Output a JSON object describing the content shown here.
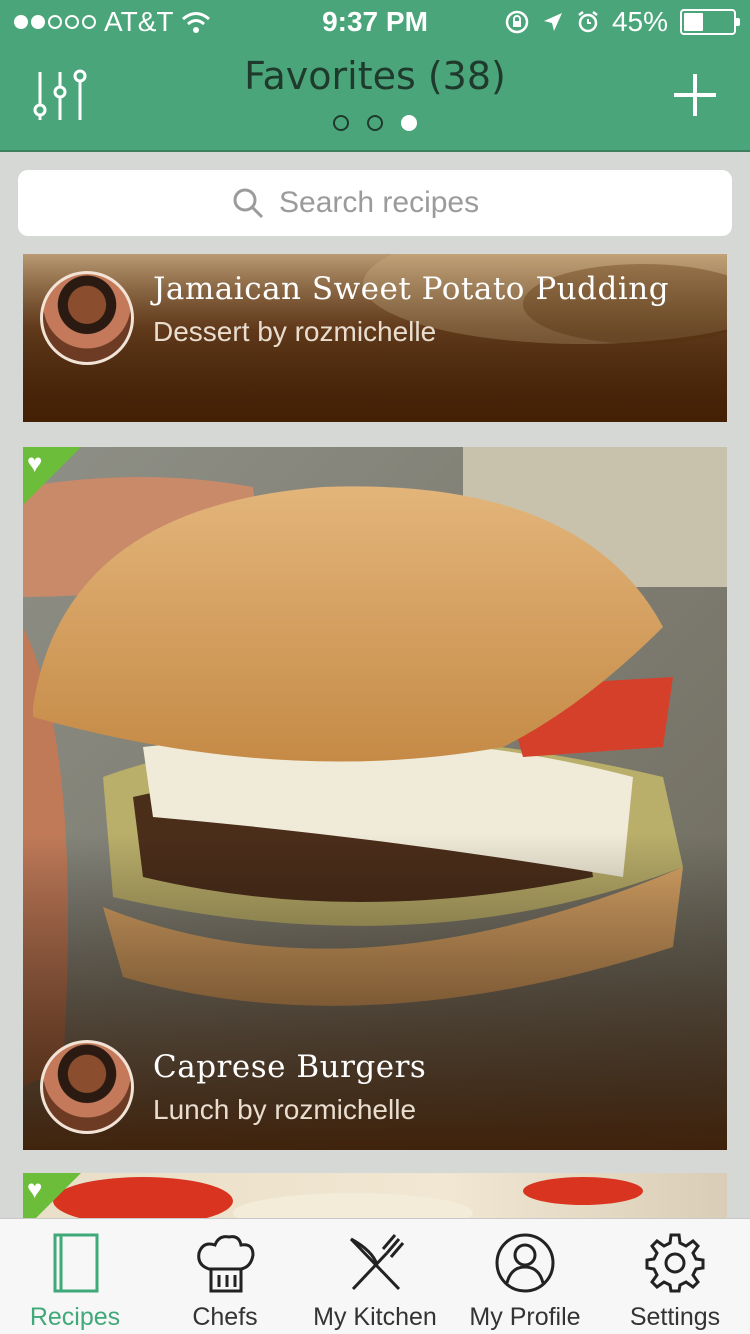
{
  "status": {
    "signal_dots": 5,
    "signal_filled": 2,
    "carrier": "AT&T",
    "time": "9:37 PM",
    "battery": "45%",
    "battery_level": 0.45
  },
  "nav": {
    "title": "Favorites (38)",
    "page_count": 3,
    "active_page": 3
  },
  "search": {
    "placeholder": "Search recipes"
  },
  "cards": [
    {
      "title": "Jamaican Sweet Potato Pudding",
      "subtitle": "Dessert by rozmichelle",
      "favorite": false
    },
    {
      "title": "Caprese Burgers",
      "subtitle": "Lunch by rozmichelle",
      "favorite": true
    },
    {
      "title": "",
      "subtitle": "",
      "favorite": true
    }
  ],
  "tabs": [
    {
      "label": "Recipes",
      "icon": "book-icon",
      "active": true
    },
    {
      "label": "Chefs",
      "icon": "chef-hat-icon",
      "active": false
    },
    {
      "label": "My Kitchen",
      "icon": "fork-knife-icon",
      "active": false
    },
    {
      "label": "My Profile",
      "icon": "profile-icon",
      "active": false
    },
    {
      "label": "Settings",
      "icon": "gear-icon",
      "active": false
    }
  ],
  "colors": {
    "brand_green": "#4aa67a",
    "active_tab": "#3fa97a",
    "favorite_badge": "#6bbd3a"
  }
}
